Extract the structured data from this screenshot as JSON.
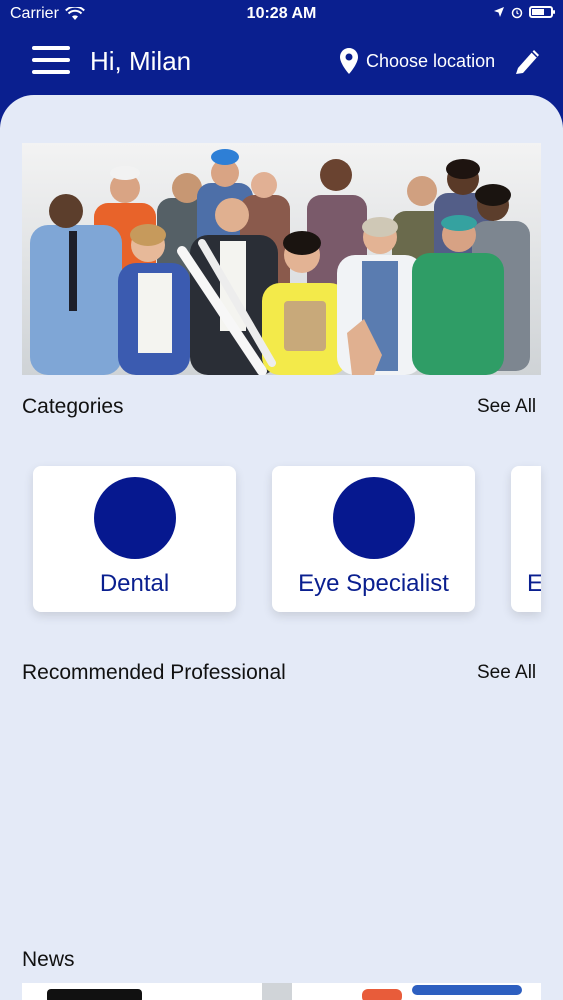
{
  "status_bar": {
    "carrier": "Carrier",
    "time": "10:28 AM"
  },
  "header": {
    "greeting": "Hi, Milan",
    "location_label": "Choose location"
  },
  "categories": {
    "title": "Categories",
    "see_all": "See All",
    "items": [
      {
        "label": "Dental"
      },
      {
        "label": "Eye Specialist"
      },
      {
        "label": "E"
      }
    ]
  },
  "recommended": {
    "title": "Recommended Professional",
    "see_all": "See All"
  },
  "news": {
    "title": "News"
  },
  "colors": {
    "primary": "#0a1f8f",
    "background": "#e4eaf7",
    "category_circle": "#06188f"
  }
}
